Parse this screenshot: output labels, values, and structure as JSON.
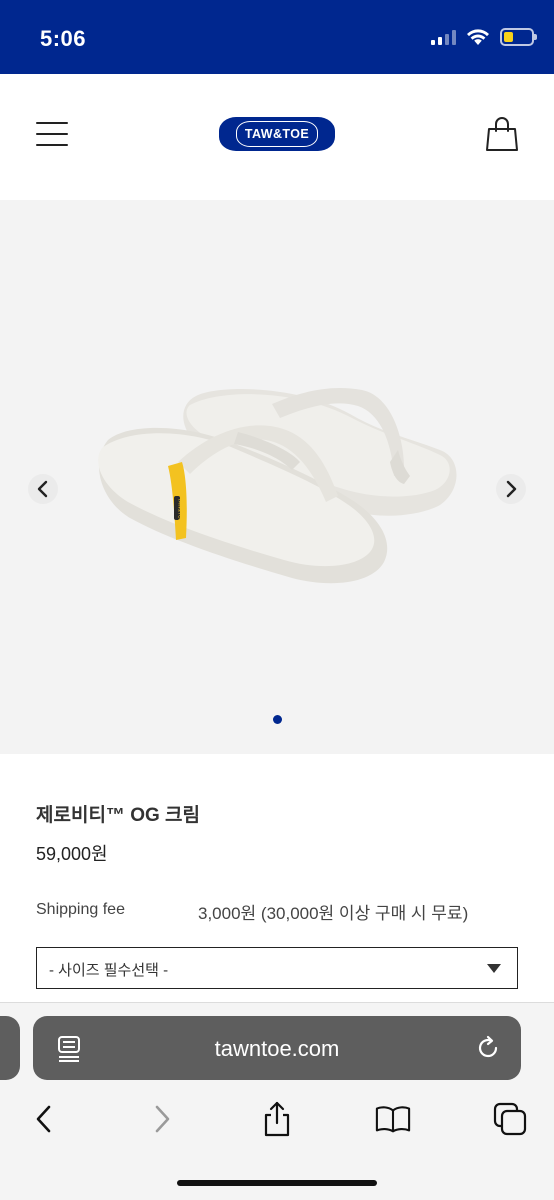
{
  "status_bar": {
    "time": "5:06",
    "background_color": "#00278f",
    "battery_level": 0.35,
    "battery_color": "#f7d21a",
    "icons": [
      "cellular-signal-icon",
      "wifi-icon",
      "battery-icon"
    ]
  },
  "header": {
    "logo_text": "TAW&TOE",
    "brand_color": "#00278f",
    "icons": [
      "hamburger-menu-icon",
      "shopping-bag-icon"
    ]
  },
  "gallery": {
    "current_slide": 1,
    "slide_count": 1,
    "strap_label": "TAW&TOE",
    "icons": [
      "chevron-left-icon",
      "chevron-right-icon"
    ]
  },
  "product": {
    "name": "제로비티™ OG 크림",
    "price": "59,000원",
    "shipping_label": "Shipping fee",
    "shipping_value": "3,000원 (30,000원 이상 구매 시 무료)",
    "size_select": {
      "selected": "- 사이즈 필수선택 -"
    }
  },
  "browser": {
    "url": "tawntoe.com",
    "icons": [
      "page-menu-icon",
      "reload-icon",
      "back-icon",
      "forward-icon",
      "share-icon",
      "bookmarks-icon",
      "tabs-icon"
    ]
  }
}
